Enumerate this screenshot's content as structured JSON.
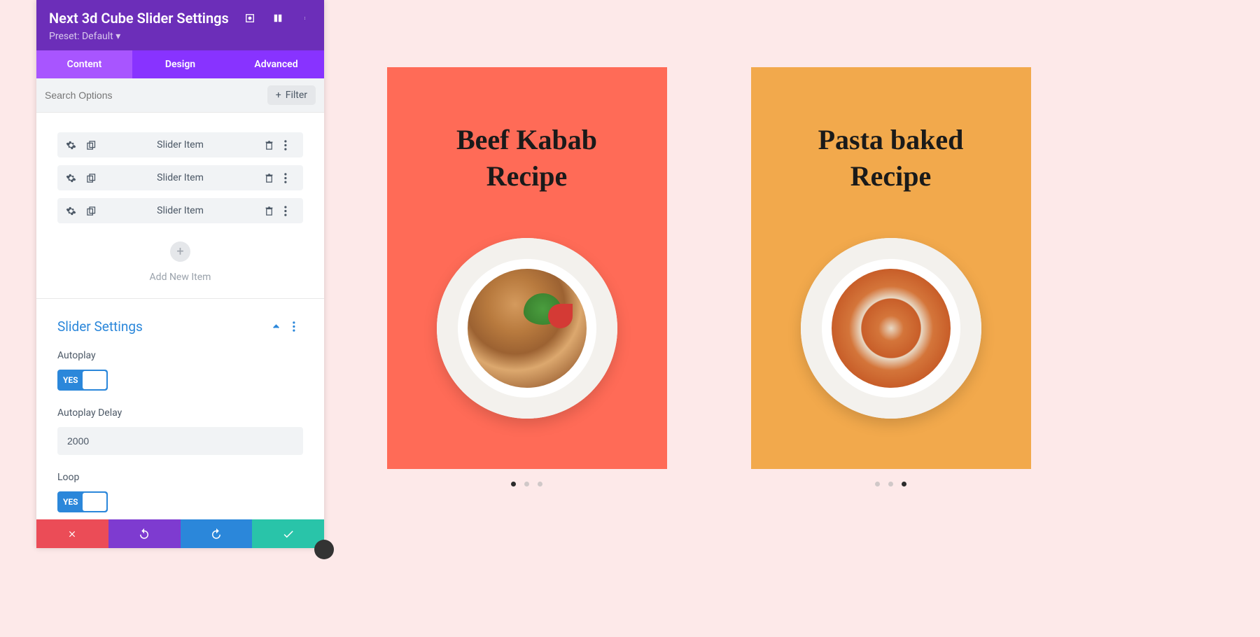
{
  "header": {
    "title": "Next 3d Cube Slider Settings",
    "preset": "Preset: Default ▾"
  },
  "tabs": {
    "content": "Content",
    "design": "Design",
    "advanced": "Advanced"
  },
  "search": {
    "placeholder": "Search Options",
    "filter_label": "Filter"
  },
  "items": [
    {
      "label": "Slider Item"
    },
    {
      "label": "Slider Item"
    },
    {
      "label": "Slider Item"
    }
  ],
  "add_item_label": "Add New Item",
  "section": {
    "title": "Slider Settings"
  },
  "settings": {
    "autoplay_label": "Autoplay",
    "autoplay_value": "YES",
    "delay_label": "Autoplay Delay",
    "delay_value": "2000",
    "loop_label": "Loop",
    "loop_value": "YES"
  },
  "preview": {
    "card1_title_line1": "Beef Kabab",
    "card1_title_line2": "Recipe",
    "card2_title_line1": "Pasta baked",
    "card2_title_line2": "Recipe"
  },
  "colors": {
    "purple_header": "#6c2eb9",
    "purple_tabs": "#8833ff",
    "blue": "#2b87da",
    "red_card": "#ff6b57",
    "orange_card": "#f2a94c"
  }
}
